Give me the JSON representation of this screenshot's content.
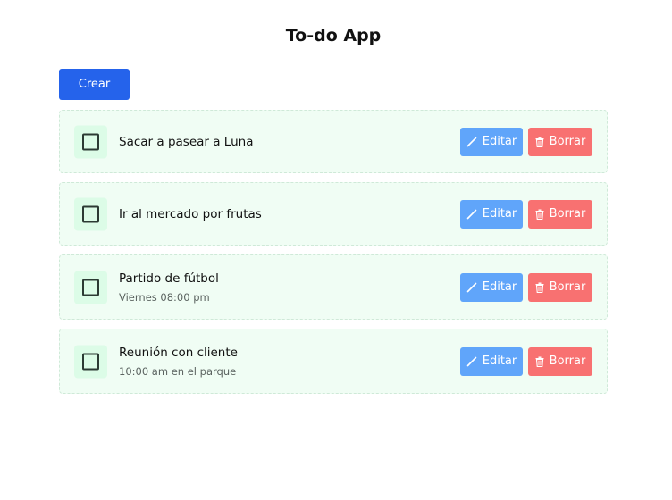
{
  "app": {
    "title": "To-do App"
  },
  "toolbar": {
    "create_label": "Crear"
  },
  "colors": {
    "primary": "#2563eb",
    "edit": "#60a5fa",
    "delete": "#f87171",
    "item_bg": "#f0fdf4",
    "checkbox_bg": "#dcfce7"
  },
  "icons": {
    "edit": "pencil-icon",
    "delete": "trash-icon"
  },
  "todos": [
    {
      "title": "Sacar a pasear a Luna",
      "subtitle": "",
      "done": false,
      "edit_label": "Editar",
      "delete_label": "Borrar"
    },
    {
      "title": "Ir al mercado por frutas",
      "subtitle": "",
      "done": false,
      "edit_label": "Editar",
      "delete_label": "Borrar"
    },
    {
      "title": "Partido de fútbol",
      "subtitle": "Viernes 08:00 pm",
      "done": false,
      "edit_label": "Editar",
      "delete_label": "Borrar"
    },
    {
      "title": "Reunión con cliente",
      "subtitle": "10:00 am en el parque",
      "done": false,
      "edit_label": "Editar",
      "delete_label": "Borrar"
    }
  ]
}
